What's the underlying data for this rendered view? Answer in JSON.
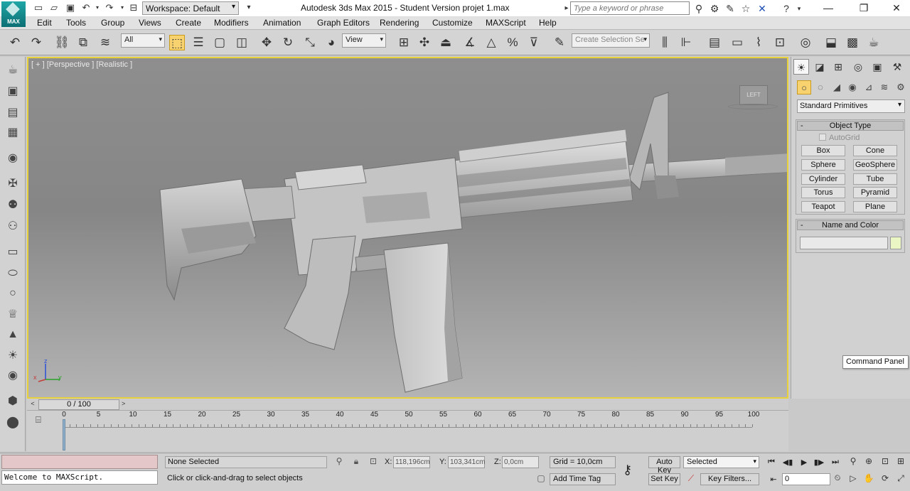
{
  "app": {
    "logo_label": "MAX",
    "title": "Autodesk 3ds Max  2015  - Student Version    projet 1.max",
    "workspace": "Workspace: Default",
    "search_placeholder": "Type a keyword or phrase"
  },
  "menu": [
    "Edit",
    "Tools",
    "Group",
    "Views",
    "Create",
    "Modifiers",
    "Animation",
    "Graph Editors",
    "Rendering",
    "Customize",
    "MAXScript",
    "Help"
  ],
  "toolbar": {
    "filter_value": "All",
    "coord_system": "View",
    "selection_set_placeholder": "Create Selection Se"
  },
  "viewport": {
    "label": "[ + ] [Perspective ] [Realistic ]",
    "viewcube_label": "LEFT",
    "axes": {
      "x": "x",
      "y": "y",
      "z": "z"
    }
  },
  "command_panel": {
    "dropdown": "Standard Primitives",
    "object_type_title": "Object Type",
    "autogrid_label": "AutoGrid",
    "primitives": [
      "Box",
      "Cone",
      "Sphere",
      "GeoSphere",
      "Cylinder",
      "Tube",
      "Torus",
      "Pyramid",
      "Teapot",
      "Plane"
    ],
    "name_color_title": "Name and Color",
    "tooltip": "Command Panel"
  },
  "timeline": {
    "frame_display": "0 / 100",
    "ticks": [
      0,
      5,
      10,
      15,
      20,
      25,
      30,
      35,
      40,
      45,
      50,
      55,
      60,
      65,
      70,
      75,
      80,
      85,
      90,
      95,
      100
    ]
  },
  "status": {
    "maxscript_output": "Welcome to MAXScript.",
    "selection": "None Selected",
    "prompt": "Click or click-and-drag to select objects",
    "x_label": "X:",
    "x_value": "118,196cm",
    "y_label": "Y:",
    "y_value": "103,341cm",
    "z_label": "Z:",
    "z_value": "0,0cm",
    "grid": "Grid = 10,0cm",
    "add_time_tag": "Add Time Tag",
    "auto_key": "Auto Key",
    "set_key": "Set Key",
    "key_mode": "Selected",
    "key_filters": "Key Filters...",
    "current_frame": "0"
  }
}
